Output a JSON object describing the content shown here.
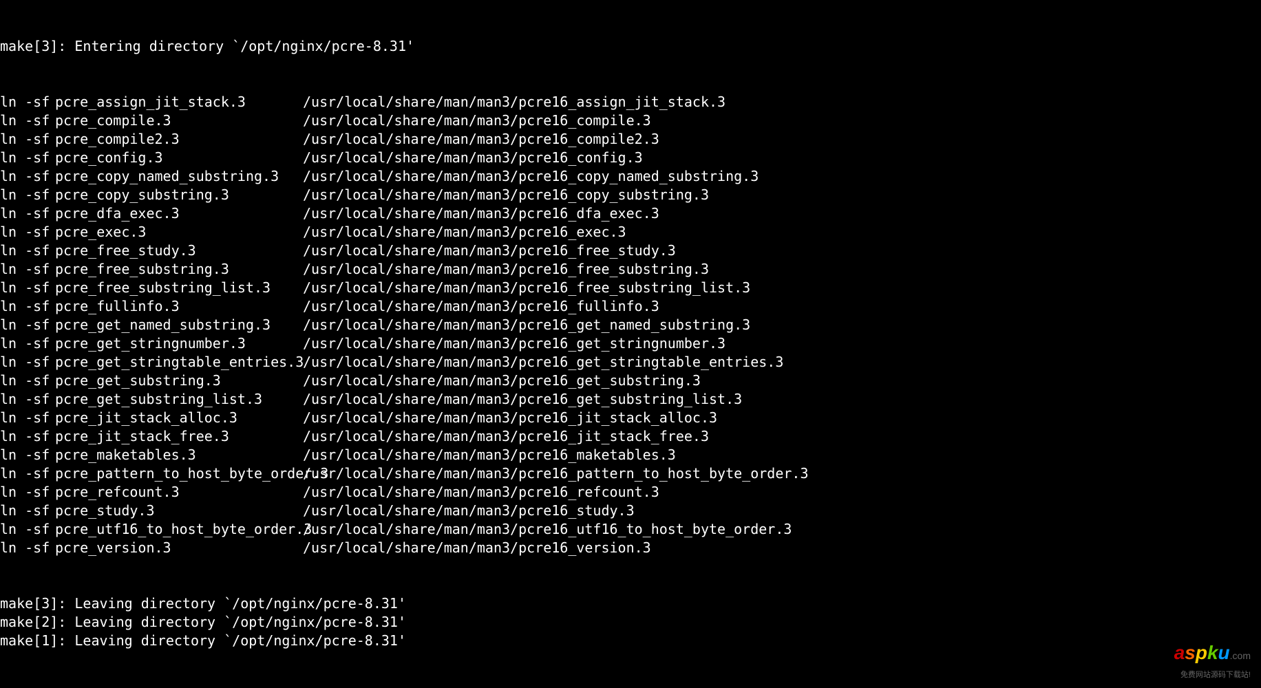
{
  "terminal": {
    "header": "make[3]: Entering directory `/opt/nginx/pcre-8.31'",
    "cmd": "ln -sf",
    "links": [
      {
        "src": "pcre_assign_jit_stack.3",
        "dst": "/usr/local/share/man/man3/pcre16_assign_jit_stack.3"
      },
      {
        "src": "pcre_compile.3",
        "dst": "/usr/local/share/man/man3/pcre16_compile.3"
      },
      {
        "src": "pcre_compile2.3",
        "dst": "/usr/local/share/man/man3/pcre16_compile2.3"
      },
      {
        "src": "pcre_config.3",
        "dst": "/usr/local/share/man/man3/pcre16_config.3"
      },
      {
        "src": "pcre_copy_named_substring.3",
        "dst": "/usr/local/share/man/man3/pcre16_copy_named_substring.3"
      },
      {
        "src": "pcre_copy_substring.3",
        "dst": "/usr/local/share/man/man3/pcre16_copy_substring.3"
      },
      {
        "src": "pcre_dfa_exec.3",
        "dst": "/usr/local/share/man/man3/pcre16_dfa_exec.3"
      },
      {
        "src": "pcre_exec.3",
        "dst": "/usr/local/share/man/man3/pcre16_exec.3"
      },
      {
        "src": "pcre_free_study.3",
        "dst": "/usr/local/share/man/man3/pcre16_free_study.3"
      },
      {
        "src": "pcre_free_substring.3",
        "dst": "/usr/local/share/man/man3/pcre16_free_substring.3"
      },
      {
        "src": "pcre_free_substring_list.3",
        "dst": "/usr/local/share/man/man3/pcre16_free_substring_list.3"
      },
      {
        "src": "pcre_fullinfo.3",
        "dst": "/usr/local/share/man/man3/pcre16_fullinfo.3"
      },
      {
        "src": "pcre_get_named_substring.3",
        "dst": "/usr/local/share/man/man3/pcre16_get_named_substring.3"
      },
      {
        "src": "pcre_get_stringnumber.3",
        "dst": "/usr/local/share/man/man3/pcre16_get_stringnumber.3"
      },
      {
        "src": "pcre_get_stringtable_entries.3",
        "dst": "/usr/local/share/man/man3/pcre16_get_stringtable_entries.3"
      },
      {
        "src": "pcre_get_substring.3",
        "dst": "/usr/local/share/man/man3/pcre16_get_substring.3"
      },
      {
        "src": "pcre_get_substring_list.3",
        "dst": "/usr/local/share/man/man3/pcre16_get_substring_list.3"
      },
      {
        "src": "pcre_jit_stack_alloc.3",
        "dst": "/usr/local/share/man/man3/pcre16_jit_stack_alloc.3"
      },
      {
        "src": "pcre_jit_stack_free.3",
        "dst": "/usr/local/share/man/man3/pcre16_jit_stack_free.3"
      },
      {
        "src": "pcre_maketables.3",
        "dst": "/usr/local/share/man/man3/pcre16_maketables.3"
      },
      {
        "src": "pcre_pattern_to_host_byte_order.3",
        "dst": "/usr/local/share/man/man3/pcre16_pattern_to_host_byte_order.3"
      },
      {
        "src": "pcre_refcount.3",
        "dst": "/usr/local/share/man/man3/pcre16_refcount.3"
      },
      {
        "src": "pcre_study.3",
        "dst": "/usr/local/share/man/man3/pcre16_study.3"
      },
      {
        "src": "pcre_utf16_to_host_byte_order.3",
        "dst": "/usr/local/share/man/man3/pcre16_utf16_to_host_byte_order.3"
      },
      {
        "src": "pcre_version.3",
        "dst": "/usr/local/share/man/man3/pcre16_version.3"
      }
    ],
    "footer": [
      "make[3]: Leaving directory `/opt/nginx/pcre-8.31'",
      "make[2]: Leaving directory `/opt/nginx/pcre-8.31'",
      "make[1]: Leaving directory `/opt/nginx/pcre-8.31'"
    ]
  },
  "watermark": {
    "brand_a": "a",
    "brand_s": "s",
    "brand_p": "p",
    "brand_k": "k",
    "brand_u": "u",
    "domain": ".com",
    "subtitle": "免费网站源码下载站!"
  }
}
